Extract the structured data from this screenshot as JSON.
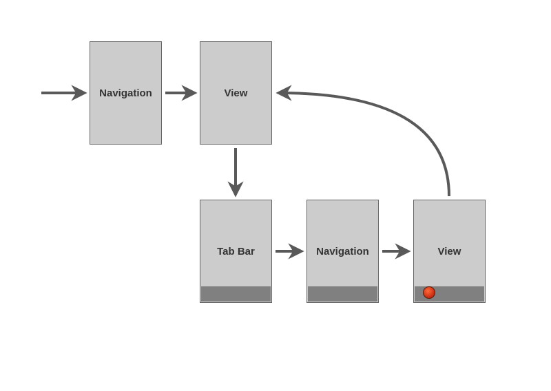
{
  "nodes": {
    "nav1": {
      "label": "Navigation"
    },
    "view1": {
      "label": "View"
    },
    "tabbar": {
      "label": "Tab Bar"
    },
    "nav2": {
      "label": "Navigation"
    },
    "view2": {
      "label": "View"
    }
  },
  "edges": [
    {
      "from": "start",
      "to": "nav1"
    },
    {
      "from": "nav1",
      "to": "view1"
    },
    {
      "from": "view1",
      "to": "tabbar"
    },
    {
      "from": "tabbar",
      "to": "nav2"
    },
    {
      "from": "nav2",
      "to": "view2"
    },
    {
      "from": "view2",
      "to": "view1"
    }
  ],
  "colors": {
    "nodeFill": "#cccccc",
    "nodeStroke": "#666666",
    "tabStrip": "#808080",
    "arrow": "#595959",
    "dot": "#d8431c",
    "background": "#ffffff"
  }
}
